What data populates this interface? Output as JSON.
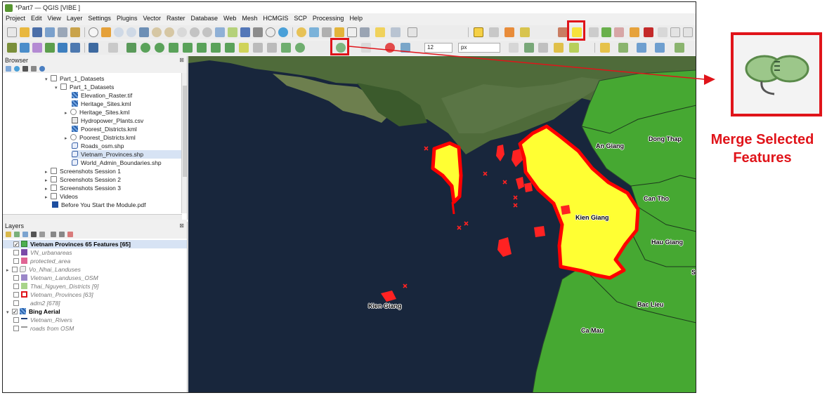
{
  "window": {
    "title": "*Part7 — QGIS [VIBE ]"
  },
  "menu": [
    "Project",
    "Edit",
    "View",
    "Layer",
    "Settings",
    "Plugins",
    "Vector",
    "Raster",
    "Database",
    "Web",
    "Mesh",
    "HCMGIS",
    "SCP",
    "Processing",
    "Help"
  ],
  "toolbar": {
    "font_size_value": "12",
    "unit_value": "px"
  },
  "browser": {
    "title": "Browser",
    "items": [
      {
        "label": "Part_1_Datasets",
        "kind": "folder"
      },
      {
        "label": "Part_1_Datasets",
        "kind": "folder"
      },
      {
        "label": "Elevation_Raster.tif",
        "kind": "raster"
      },
      {
        "label": "Heritage_Sites.kml",
        "kind": "raster"
      },
      {
        "label": "Heritage_Sites.kml",
        "kind": "vector"
      },
      {
        "label": "Hydropower_Plants.csv",
        "kind": "table"
      },
      {
        "label": "Poorest_Districts.kml",
        "kind": "raster"
      },
      {
        "label": "Poorest_Districts.kml",
        "kind": "vector"
      },
      {
        "label": "Roads_osm.shp",
        "kind": "poly"
      },
      {
        "label": "Vietnam_Provinces.shp",
        "kind": "poly"
      },
      {
        "label": "World_Admin_Boundaries.shp",
        "kind": "poly"
      },
      {
        "label": "Screenshots Session 1",
        "kind": "folder"
      },
      {
        "label": "Screenshots Session 2",
        "kind": "folder"
      },
      {
        "label": "Screenshots Session 3",
        "kind": "folder"
      },
      {
        "label": "Videos",
        "kind": "folder"
      },
      {
        "label": "Before You Start the Module.pdf",
        "kind": "pdf"
      }
    ]
  },
  "layers": {
    "title": "Layers",
    "items": [
      {
        "label": "Vietnam Provinces 65 Features [65]",
        "checked": true,
        "color": "#4caf50"
      },
      {
        "label": "VN_urbanareas",
        "checked": false,
        "color": "#7b4aa8"
      },
      {
        "label": "protected_area",
        "checked": false,
        "color": "#e06494"
      },
      {
        "label": "Vo_Nhai_Landuses",
        "checked": false,
        "color": "#b0b0b0"
      },
      {
        "label": "Vietnam_Landuses_OSM",
        "checked": false,
        "color": "#9b87c9"
      },
      {
        "label": "Thai_Nguyen_Districts [9]",
        "checked": false,
        "color": "#a8d48a"
      },
      {
        "label": "Vietnam_Provinces [63]",
        "checked": false,
        "color": "#ffffff"
      },
      {
        "label": "adm2 [678]",
        "checked": false,
        "color": ""
      },
      {
        "label": "Bing Aerial",
        "checked": true,
        "color": ""
      },
      {
        "label": "Vietnam_Rivers",
        "checked": false,
        "color": "#1f3f7a"
      },
      {
        "label": "roads from OSM",
        "checked": false,
        "color": "#999999"
      }
    ]
  },
  "map": {
    "labels": [
      "An Giang",
      "Dong Thap",
      "Can Tho",
      "Kien Giang",
      "Hau Giang",
      "Bac Lieu",
      "Ca Mau",
      "Kien Giang",
      "S"
    ]
  },
  "callout": {
    "line1": "Merge Selected",
    "line2": "Features"
  },
  "colors": {
    "accent": "#e0141a",
    "province_fill": "#4caf50",
    "selected_fill": "#ffff00",
    "selection_outline": "#ff0000"
  }
}
